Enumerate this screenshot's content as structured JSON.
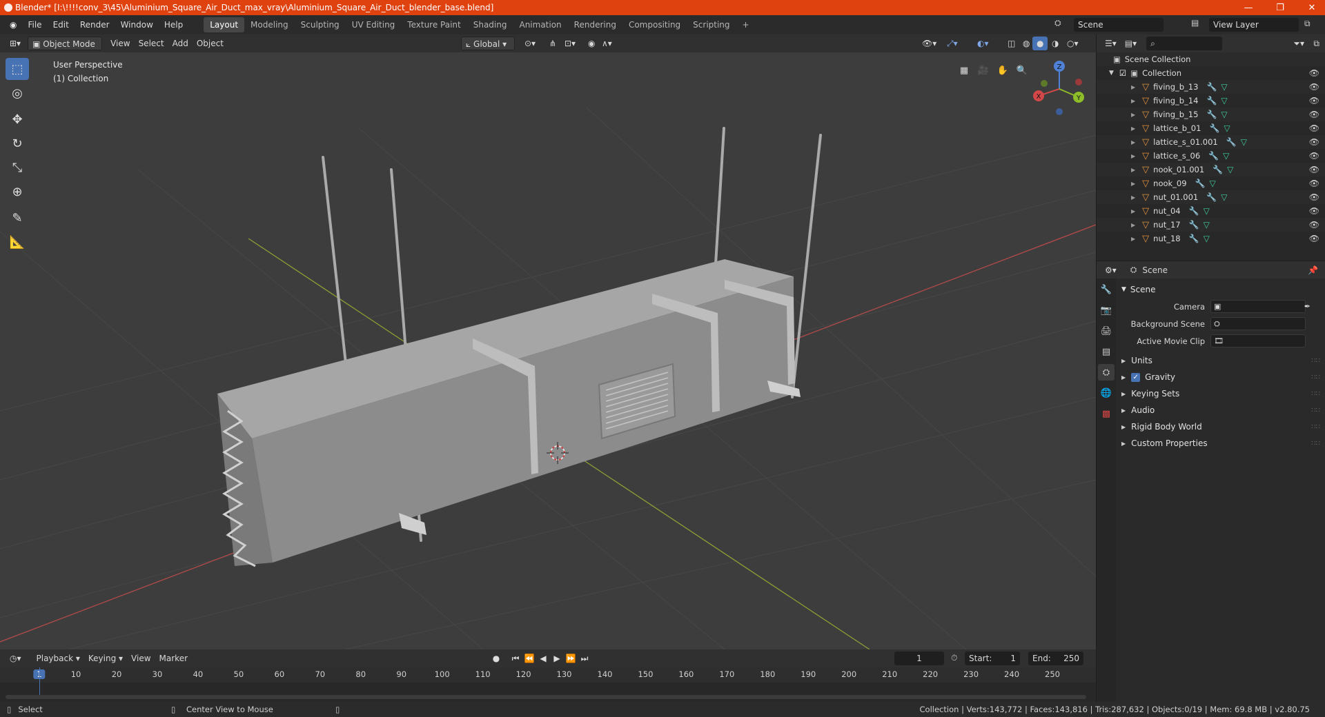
{
  "titlebar": {
    "title": "Blender* [I:\\!!!!conv_3\\45\\Aluminium_Square_Air_Duct_max_vray\\Aluminium_Square_Air_Duct_blender_base.blend]",
    "minimize": "—",
    "maximize": "❐",
    "close": "✕"
  },
  "menu": [
    "File",
    "Edit",
    "Render",
    "Window",
    "Help"
  ],
  "workspaces": [
    "Layout",
    "Modeling",
    "Sculpting",
    "UV Editing",
    "Texture Paint",
    "Shading",
    "Animation",
    "Rendering",
    "Compositing",
    "Scripting"
  ],
  "workspace_add": "+",
  "scene_field": "Scene",
  "view_layer_field": "View Layer",
  "viewport_header": {
    "mode": "Object Mode",
    "menus": [
      "View",
      "Select",
      "Add",
      "Object"
    ],
    "transform_orientation": "Global"
  },
  "viewport": {
    "perspective_label": "User Perspective",
    "collection_label": "(1) Collection",
    "gizmo": {
      "x": "X",
      "y": "Y",
      "z": "Z"
    },
    "colors": {
      "bg": "#3d3d3d",
      "grid": "#474747",
      "x_axis": "#b34a4a",
      "y_axis": "#8aa035",
      "duct": "#8a8a8a"
    }
  },
  "outliner": {
    "root": "Scene Collection",
    "collection": "Collection",
    "items": [
      "fiving_b_13",
      "fiving_b_14",
      "fiving_b_15",
      "lattice_b_01",
      "lattice_s_01.001",
      "lattice_s_06",
      "nook_01.001",
      "nook_09",
      "nut_01.001",
      "nut_04",
      "nut_17",
      "nut_18"
    ]
  },
  "properties": {
    "context": "Scene",
    "section": "Scene",
    "fields": {
      "camera_label": "Camera",
      "background_scene_label": "Background Scene",
      "active_movie_clip_label": "Active Movie Clip"
    },
    "panels": [
      "Units",
      "Gravity",
      "Keying Sets",
      "Audio",
      "Rigid Body World",
      "Custom Properties"
    ],
    "gravity_checked": true
  },
  "timeline": {
    "menus": [
      "Playback",
      "Keying",
      "View",
      "Marker"
    ],
    "current_frame": "1",
    "start_label": "Start:",
    "start_value": "1",
    "end_label": "End:",
    "end_value": "250",
    "ticks": [
      "1",
      "10",
      "20",
      "30",
      "40",
      "50",
      "60",
      "70",
      "80",
      "90",
      "100",
      "110",
      "120",
      "130",
      "140",
      "150",
      "160",
      "170",
      "180",
      "190",
      "200",
      "210",
      "220",
      "230",
      "240",
      "250"
    ]
  },
  "statusbar": {
    "left_action": "Select",
    "mid_action": "Center View to Mouse",
    "stats": "Collection | Verts:143,772 | Faces:143,816 | Tris:287,632 | Objects:0/19 | Mem: 69.8 MB | v2.80.75"
  }
}
